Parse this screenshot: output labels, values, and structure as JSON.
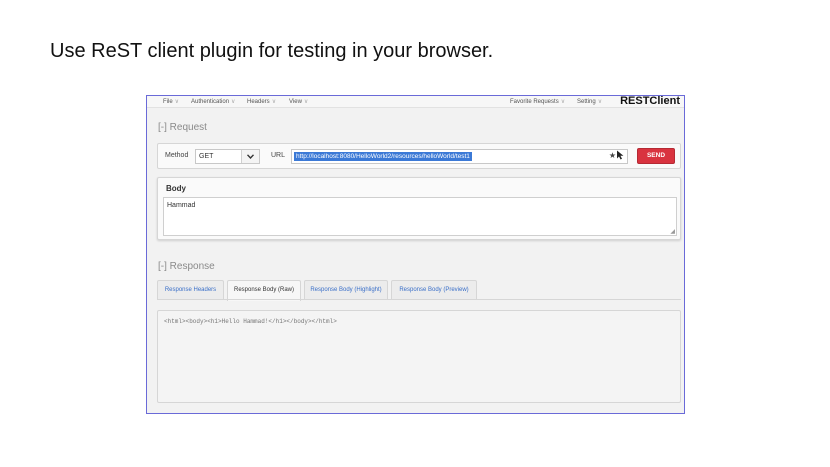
{
  "slide": {
    "title": "Use ReST client plugin for testing in your browser."
  },
  "menu": {
    "items": [
      "File",
      "Authentication",
      "Headers",
      "View"
    ],
    "right_items": [
      "Favorite Requests",
      "Setting"
    ],
    "caret": "∨",
    "brand": "RESTClient"
  },
  "request": {
    "section_title": "[-] Request",
    "method_label": "Method",
    "method_value": "GET",
    "url_label": "URL",
    "url_value": "http://localhost:8080/HelloWorld2/resources/helloWorld/test1",
    "send_label": "SEND"
  },
  "body": {
    "title": "Body",
    "value": "Hammad"
  },
  "response": {
    "section_title": "[-] Response",
    "tabs": [
      "Response Headers",
      "Response Body (Raw)",
      "Response Body (Highlight)",
      "Response Body (Preview)"
    ],
    "active_tab": "Response Body (Raw)",
    "content": "<html><body><h1>Hello Hammad!</h1></body></html>"
  },
  "icons": {
    "star": "star-icon",
    "cursor": "cursor-icon",
    "chevron": "chevron-down-icon",
    "resize": "resize-grip-icon"
  },
  "colors": {
    "send": "#d9333f",
    "url_highlight": "#3b79d6",
    "tab_link": "#3a6fc8",
    "frame_border": "#6a6ad8"
  }
}
